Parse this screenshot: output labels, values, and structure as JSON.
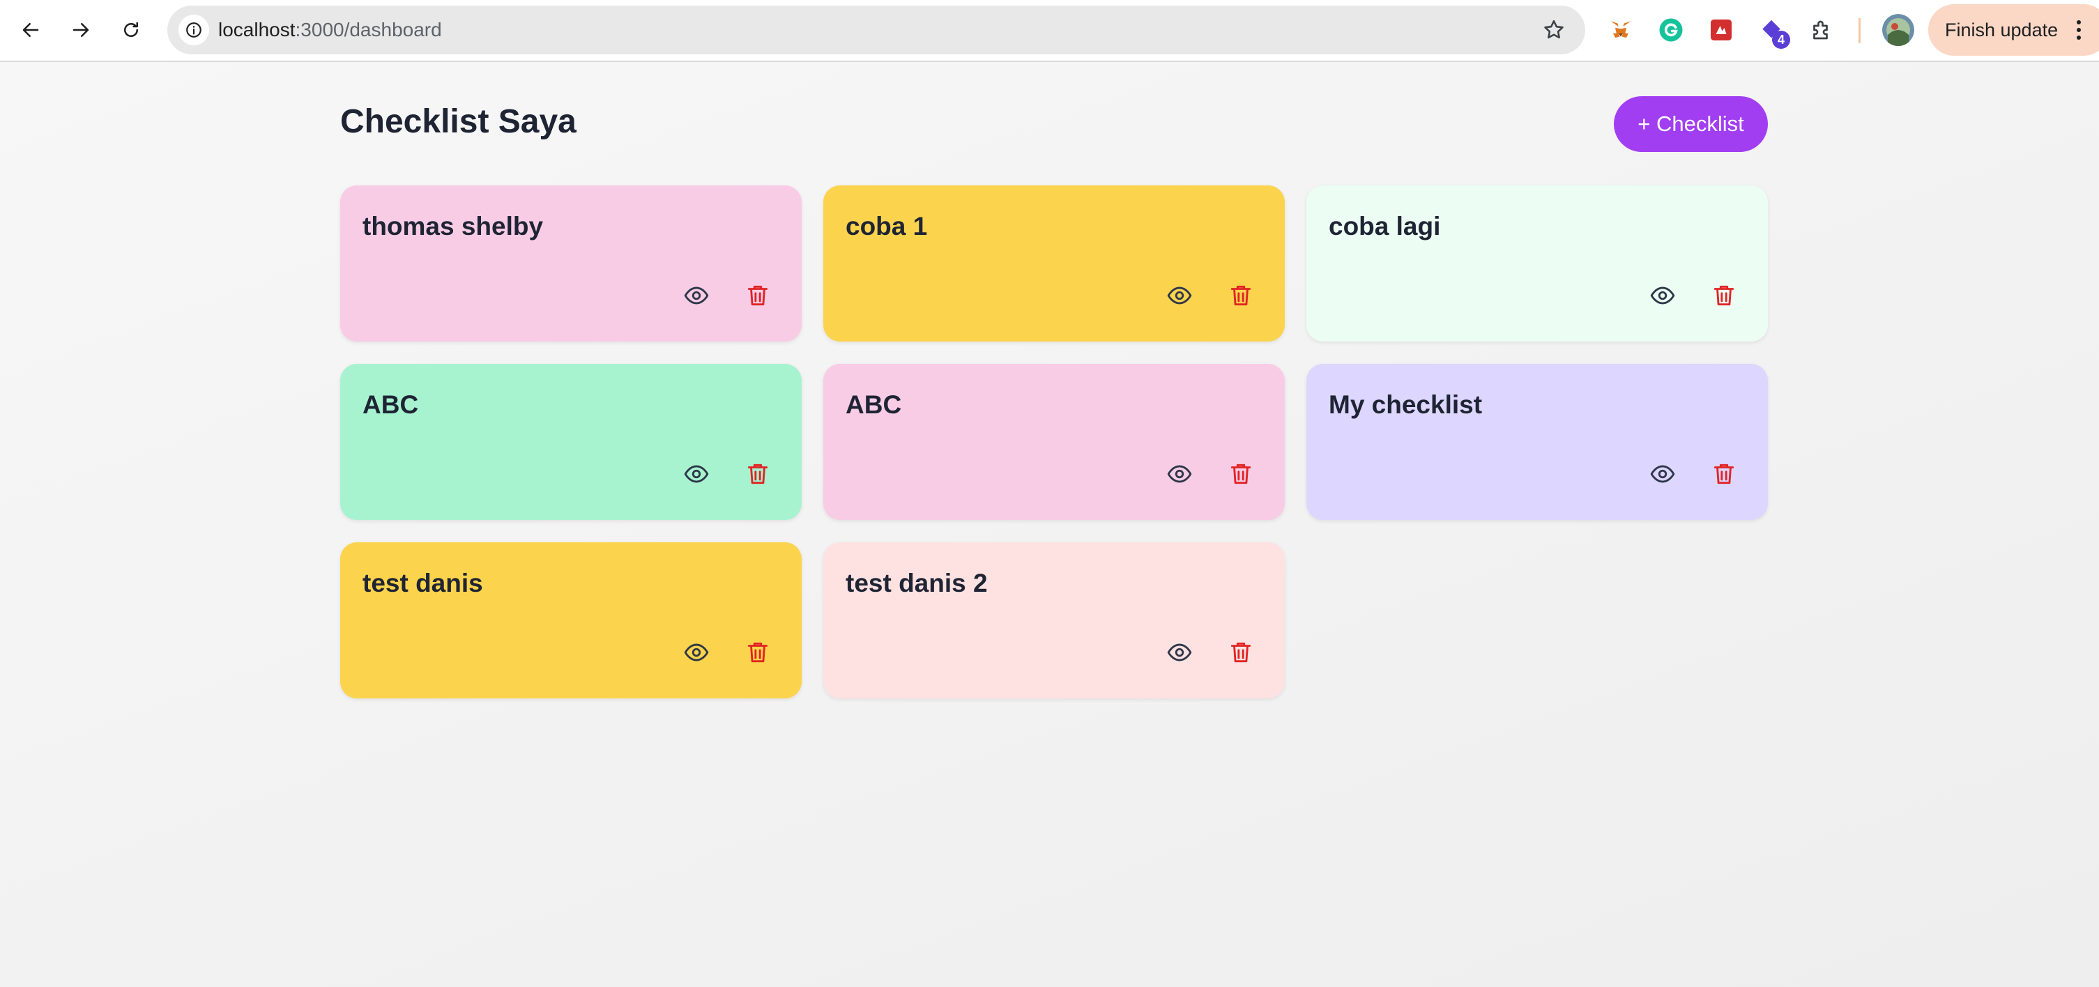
{
  "browser": {
    "url_host": "localhost",
    "url_path": ":3000/dashboard",
    "finish_update_label": "Finish update",
    "extensions": [
      {
        "name": "metamask-icon",
        "color": "#e2761b"
      },
      {
        "name": "grammarly-icon",
        "color": "#15c39a"
      },
      {
        "name": "red-extension-icon",
        "color": "#d32f2f"
      },
      {
        "name": "purple-extension-icon",
        "color": "#5b3ed6",
        "badge": "4"
      },
      {
        "name": "puzzle-extensions-icon",
        "color": "#3c4043"
      }
    ]
  },
  "header": {
    "title": "Checklist Saya",
    "add_button_label": "+ Checklist"
  },
  "colors": {
    "accent": "#a23ef2",
    "delete": "#e02424",
    "view": "#2d3748"
  },
  "checklists": [
    {
      "title": "thomas shelby",
      "color": "#f9cce6"
    },
    {
      "title": "coba 1",
      "color": "#fcd34d"
    },
    {
      "title": "coba lagi",
      "color": "#ecfdf3"
    },
    {
      "title": "ABC",
      "color": "#a7f3d0"
    },
    {
      "title": "ABC",
      "color": "#f9cce6"
    },
    {
      "title": "My checklist",
      "color": "#ddd6fe"
    },
    {
      "title": "test danis",
      "color": "#fcd34d"
    },
    {
      "title": "test danis 2",
      "color": "#fee2e2"
    }
  ]
}
